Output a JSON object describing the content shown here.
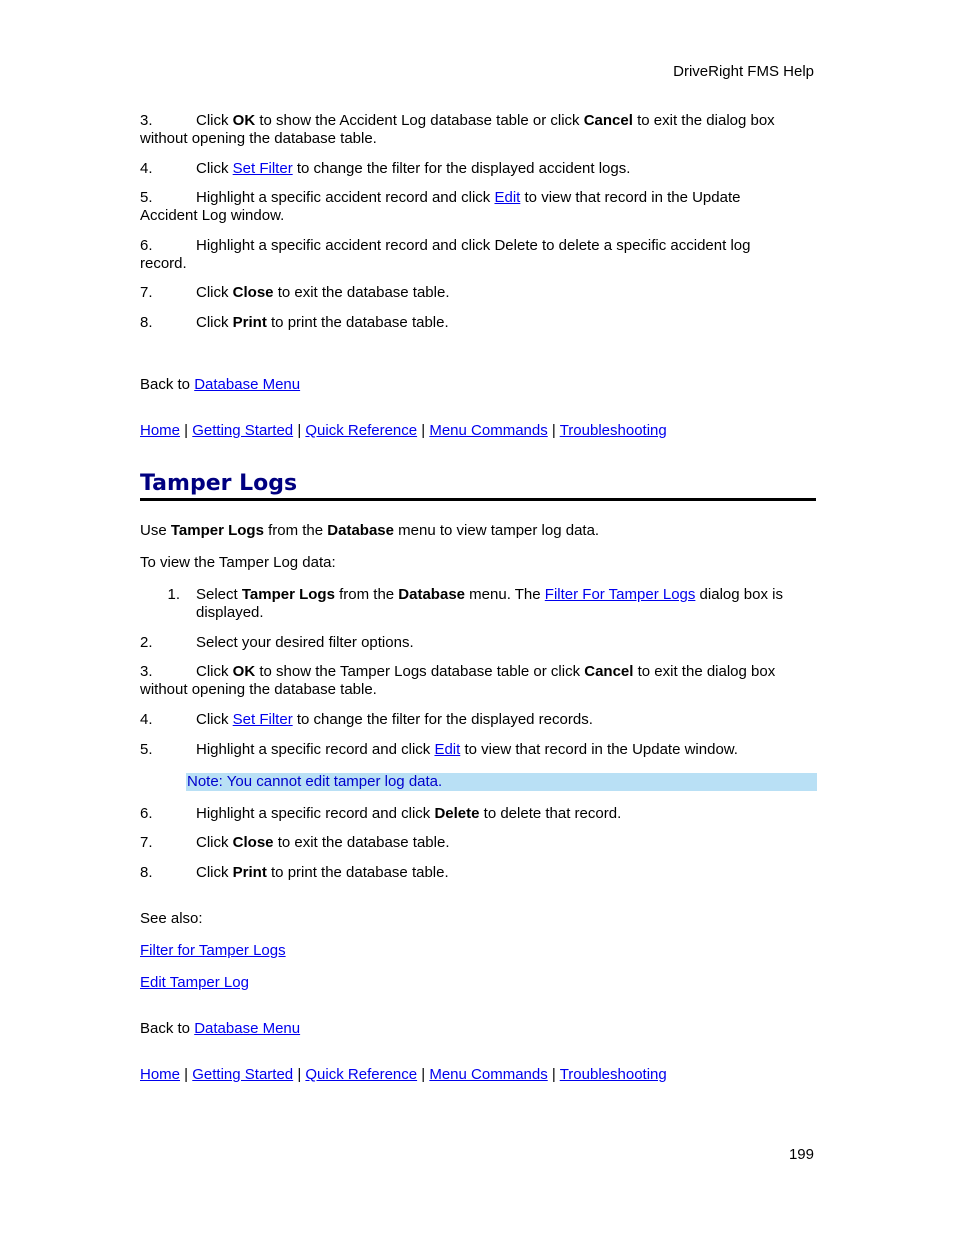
{
  "header": {
    "title": "DriveRight FMS Help"
  },
  "accident_section": {
    "steps": [
      {
        "num": "3.",
        "parts": [
          [
            "t",
            "Click "
          ],
          [
            "b",
            "OK"
          ],
          [
            "t",
            " to show the Accident Log database table or click "
          ],
          [
            "b",
            "Cancel"
          ],
          [
            "t",
            " to exit the dialog box"
          ]
        ],
        "cont": "without opening the database table."
      },
      {
        "num": "4.",
        "pre": "Click ",
        "link": "Set Filter",
        "post": " to change the filter for the displayed accident logs."
      },
      {
        "num": "5.",
        "pre": "Highlight a specific accident record and click ",
        "link": "Edit",
        "post": " to view that record in the Update",
        "cont": "Accident Log window."
      },
      {
        "num": "6.",
        "text": "Highlight a specific accident record and click Delete to delete a specific accident log",
        "cont": "record."
      },
      {
        "num": "7.",
        "pre": "Click ",
        "bold": "Close",
        "post": " to exit the database table."
      },
      {
        "num": "8.",
        "pre": "Click ",
        "bold": "Print",
        "post": " to print the database table."
      }
    ],
    "back_to": {
      "prefix": "Back to ",
      "link": "Database Menu"
    }
  },
  "nav": {
    "links": [
      "Home",
      "Getting Started",
      "Quick Reference",
      "Menu Commands",
      "Troubleshooting"
    ],
    "separator": " | "
  },
  "tamper_section": {
    "title": "Tamper Logs",
    "intro": {
      "pre": "Use ",
      "b1": "Tamper Logs",
      "mid": " from the ",
      "b2": "Database",
      "post": " menu to view tamper log data."
    },
    "lead": "To view the Tamper Log data:",
    "step1": {
      "num": "1.",
      "pre": "Select ",
      "b1": "Tamper Logs",
      "mid": " from the ",
      "b2": "Database",
      "mid2": " menu. The ",
      "link": "Filter For Tamper Logs",
      "post": " dialog box is",
      "cont": "displayed."
    },
    "step2": {
      "num": "2.",
      "text": "Select your desired filter options."
    },
    "step3": {
      "num": "3.",
      "pre": "Click ",
      "b1": "OK",
      "mid": " to show the Tamper Logs database table or click ",
      "b2": "Cancel",
      "post": " to exit the dialog box",
      "cont": "without opening the database table."
    },
    "step4": {
      "num": "4.",
      "pre": "Click ",
      "link": "Set Filter",
      "post": " to change the filter for the displayed records."
    },
    "step5": {
      "num": "5.",
      "pre": "Highlight a specific record and click ",
      "link": "Edit",
      "post": " to view that record in the Update window."
    },
    "note": "Note: You cannot edit tamper log data.",
    "step6": {
      "num": "6.",
      "pre": "Highlight a specific record and click ",
      "bold": "Delete",
      "post": " to delete that record."
    },
    "step7": {
      "num": "7.",
      "pre": "Click ",
      "bold": "Close",
      "post": " to exit the database table."
    },
    "step8": {
      "num": "8.",
      "pre": "Click ",
      "bold": "Print",
      "post": " to print the database table."
    },
    "see_also": {
      "label": "See also:",
      "links": [
        "Filter for Tamper Logs",
        "Edit Tamper Log"
      ]
    },
    "back_to": {
      "prefix": "Back to ",
      "link": "Database Menu"
    }
  },
  "colors": {
    "link": "#0000ee",
    "heading": "#000080",
    "note_bg": "#b9e0f5",
    "note_text": "#0000cc"
  },
  "page_number": "199"
}
